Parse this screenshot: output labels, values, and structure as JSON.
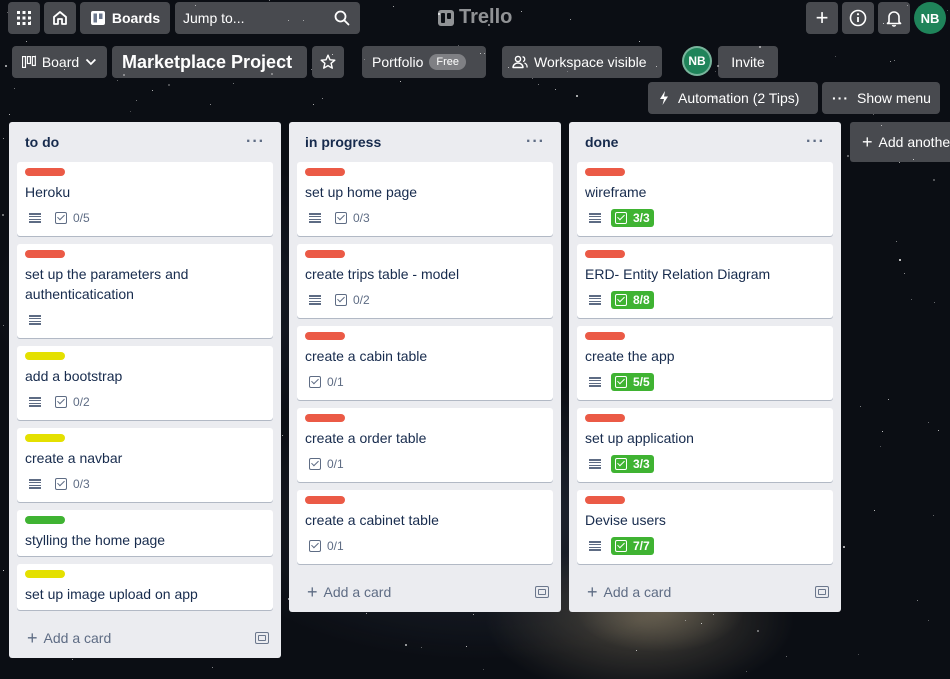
{
  "topbar": {
    "boards_label": "Boards",
    "search_placeholder": "Jump to...",
    "logo_text": "Trello",
    "avatar_initials": "NB"
  },
  "board_header": {
    "view_label": "Board",
    "title": "Marketplace Project",
    "workspace_label": "Portfolio",
    "workspace_badge": "Free",
    "visibility_label": "Workspace visible",
    "member_initials": "NB",
    "invite_label": "Invite",
    "automation_label": "Automation (2 Tips)",
    "show_menu_label": "Show menu"
  },
  "label_colors": {
    "red": "#eb5a46",
    "yellow": "#e4e000",
    "green": "#3fb332"
  },
  "lists": [
    {
      "title": "to do",
      "add_card_label": "Add a card",
      "cards": [
        {
          "label": "red",
          "title": "Heroku",
          "description": true,
          "checklist": "0/5",
          "complete": false
        },
        {
          "label": "red",
          "title": "set up the parameters and authenticatication",
          "description": true,
          "checklist": null,
          "complete": false
        },
        {
          "label": "yellow",
          "title": "add a bootstrap",
          "description": true,
          "checklist": "0/2",
          "complete": false
        },
        {
          "label": "yellow",
          "title": "create a navbar",
          "description": true,
          "checklist": "0/3",
          "complete": false
        },
        {
          "label": "green",
          "title": "stylling the home page",
          "description": false,
          "checklist": null,
          "complete": false
        },
        {
          "label": "yellow",
          "title": "set up image upload on app",
          "description": false,
          "checklist": null,
          "complete": false
        }
      ]
    },
    {
      "title": "in progress",
      "add_card_label": "Add a card",
      "cards": [
        {
          "label": "red",
          "title": "set up home page",
          "description": true,
          "checklist": "0/3",
          "complete": false
        },
        {
          "label": "red",
          "title": "create trips table - model",
          "description": true,
          "checklist": "0/2",
          "complete": false
        },
        {
          "label": "red",
          "title": "create a cabin table",
          "description": false,
          "checklist": "0/1",
          "complete": false
        },
        {
          "label": "red",
          "title": "create a order table",
          "description": false,
          "checklist": "0/1",
          "complete": false
        },
        {
          "label": "red",
          "title": "create a cabinet table",
          "description": false,
          "checklist": "0/1",
          "complete": false
        }
      ]
    },
    {
      "title": "done",
      "add_card_label": "Add a card",
      "cards": [
        {
          "label": "red",
          "title": "wireframe",
          "description": true,
          "checklist": "3/3",
          "complete": true
        },
        {
          "label": "red",
          "title": "ERD- Entity Relation Diagram",
          "description": true,
          "checklist": "8/8",
          "complete": true
        },
        {
          "label": "red",
          "title": "create the app",
          "description": true,
          "checklist": "5/5",
          "complete": true
        },
        {
          "label": "red",
          "title": "set up application",
          "description": true,
          "checklist": "3/3",
          "complete": true
        },
        {
          "label": "red",
          "title": "Devise users",
          "description": true,
          "checklist": "7/7",
          "complete": true
        }
      ]
    }
  ],
  "add_list_label": "Add another list"
}
